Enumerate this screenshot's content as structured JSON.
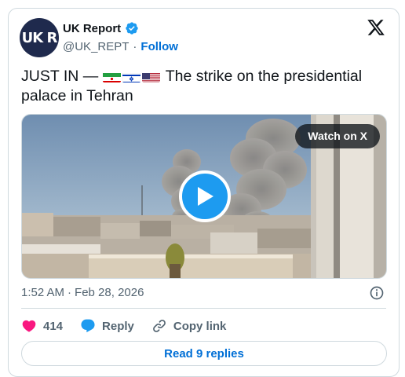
{
  "author": {
    "avatar_text": "UK R",
    "display_name": "UK Report",
    "handle": "@UK_REPT",
    "separator": "·",
    "follow_label": "Follow"
  },
  "tweet": {
    "text_lead": "JUST IN  —",
    "text_body": " The strike on the presidential palace in Tehran",
    "flags": [
      "iran-flag",
      "israel-flag",
      "us-flag"
    ]
  },
  "media": {
    "watch_label": "Watch on X"
  },
  "meta": {
    "time": "1:52 AM",
    "separator": "·",
    "date": "Feb 28, 2026"
  },
  "actions": {
    "likes": "414",
    "reply_label": "Reply",
    "copy_label": "Copy link"
  },
  "footer": {
    "read_replies_label": "Read 9 replies"
  },
  "colors": {
    "accent": "#1d9bf0",
    "link": "#006fd6",
    "like": "#f91880",
    "muted": "#536471"
  }
}
